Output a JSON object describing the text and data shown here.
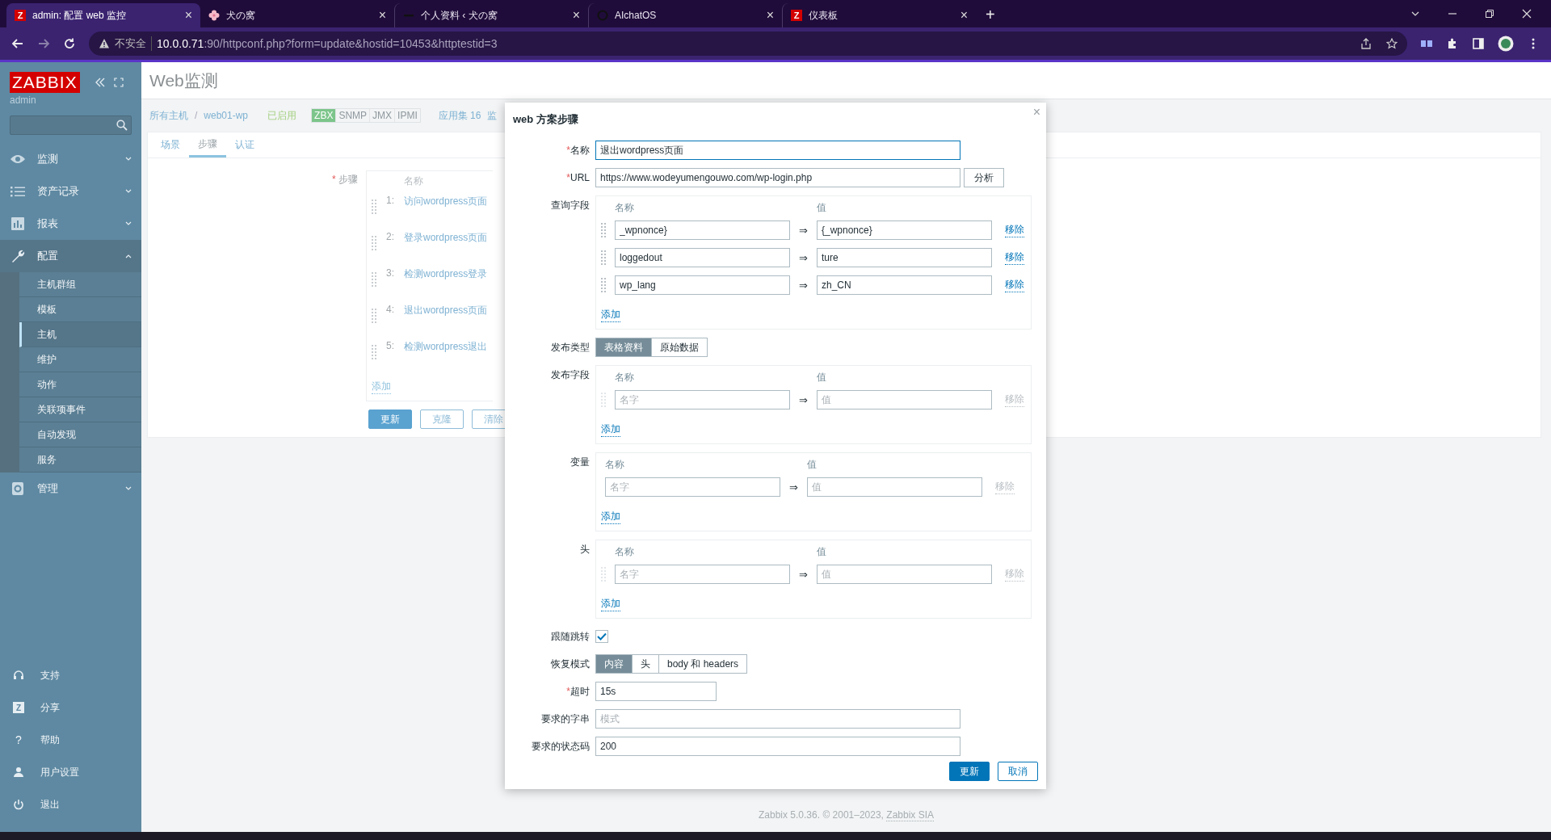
{
  "browser": {
    "tabs": [
      {
        "title": "admin: 配置 web 监控",
        "selected": true,
        "kind": "letter",
        "favicon_text": "Z",
        "close": "×"
      },
      {
        "title": "犬の窝",
        "selected": false,
        "kind": "flower",
        "close": "×"
      },
      {
        "title": "个人资料 ‹ 犬の窝",
        "selected": false,
        "kind": "dash",
        "close": "×"
      },
      {
        "title": "AIchatOS",
        "selected": false,
        "kind": "ring",
        "close": "×"
      },
      {
        "title": "仪表板",
        "selected": false,
        "kind": "letter",
        "favicon_text": "Z",
        "close": "×"
      }
    ],
    "new_tab": "+",
    "security": "不安全",
    "url_host": "10.0.0.71",
    "url_rest": ":90/httpconf.php?form=update&hostid=10453&httptestid=3"
  },
  "sidebar": {
    "logo": "ZABBIX",
    "user": "admin",
    "menu": [
      {
        "label": "监测",
        "kind": "eye",
        "expanded": false
      },
      {
        "label": "资产记录",
        "kind": "list",
        "expanded": false
      },
      {
        "label": "报表",
        "kind": "chart",
        "expanded": false
      },
      {
        "label": "配置",
        "kind": "wrench",
        "expanded": true,
        "children": [
          {
            "label": "主机群组",
            "selected": false
          },
          {
            "label": "模板",
            "selected": false
          },
          {
            "label": "主机",
            "selected": true
          },
          {
            "label": "维护",
            "selected": false
          },
          {
            "label": "动作",
            "selected": false
          },
          {
            "label": "关联项事件",
            "selected": false
          },
          {
            "label": "自动发现",
            "selected": false
          },
          {
            "label": "服务",
            "selected": false
          }
        ]
      },
      {
        "label": "管理",
        "kind": "gear",
        "expanded": false
      }
    ],
    "bottom": [
      {
        "label": "支持",
        "kind": "headset"
      },
      {
        "label": "分享",
        "kind": "letter",
        "icon_text": "Z"
      },
      {
        "label": "帮助",
        "kind": "question",
        "icon_text": "?"
      },
      {
        "label": "用户设置",
        "kind": "user"
      },
      {
        "label": "退出",
        "kind": "power"
      }
    ]
  },
  "page": {
    "title": "Web监测",
    "breadcrumb": [
      {
        "label": "所有主机",
        "separator": "/"
      },
      {
        "label": "web01-wp"
      }
    ],
    "status": "已启用",
    "availability": [
      {
        "label": "ZBX",
        "on": true
      },
      {
        "label": "SNMP",
        "on": false
      },
      {
        "label": "JMX",
        "on": false
      },
      {
        "label": "IPMI",
        "on": false
      }
    ],
    "applications": "应用集 16",
    "cut_link": "监",
    "tabs": [
      {
        "label": "场景",
        "selected": false
      },
      {
        "label": "步骤",
        "selected": true
      },
      {
        "label": "认证",
        "selected": false
      }
    ],
    "steps": {
      "label": "步骤",
      "mark": "*",
      "header": "名称",
      "rows": [
        {
          "number": "1:",
          "name": "访问wordpress页面"
        },
        {
          "number": "2:",
          "name": "登录wordpress页面"
        },
        {
          "number": "3:",
          "name": "检测wordpress登录"
        },
        {
          "number": "4:",
          "name": "退出wordpress页面"
        },
        {
          "number": "5:",
          "name": "检测wordpress退出"
        }
      ],
      "add": "添加"
    },
    "buttons": [
      {
        "label": "更新",
        "primary": true
      },
      {
        "label": "克隆",
        "primary": false
      },
      {
        "label": "清除",
        "primary": false
      }
    ],
    "footer": {
      "text": "Zabbix 5.0.36. © 2001–2023,",
      "link": "Zabbix SIA"
    }
  },
  "dialog": {
    "title": "web 方案步骤",
    "close": "×",
    "form": [
      {
        "kind": "input",
        "label": "名称",
        "mark": "*",
        "value": "退出wordpress页面",
        "focused": true
      },
      {
        "kind": "url",
        "label": "URL",
        "mark": "*",
        "value": "https://www.wodeyumengouwo.com/wp-login.php",
        "button": "分析"
      },
      {
        "kind": "pairs",
        "label": "查询字段",
        "draggable": true,
        "header_name": "名称",
        "header_value": "值",
        "add": "添加",
        "rows": [
          {
            "name": "_wpnonce}",
            "value": "{_wpnonce}",
            "arrow": "⇒",
            "remove": "移除",
            "disabled": false
          },
          {
            "name": "loggedout",
            "value": "ture",
            "arrow": "⇒",
            "remove": "移除",
            "disabled": false
          },
          {
            "name": "wp_lang",
            "value": "zh_CN",
            "arrow": "⇒",
            "remove": "移除",
            "disabled": false
          }
        ]
      },
      {
        "kind": "segmented",
        "label": "发布类型",
        "options": [
          {
            "label": "表格资料",
            "selected": true
          },
          {
            "label": "原始数据",
            "selected": false
          }
        ]
      },
      {
        "kind": "pairs",
        "label": "发布字段",
        "draggable": true,
        "header_name": "名称",
        "header_value": "值",
        "add": "添加",
        "rows": [
          {
            "name_placeholder": "名字",
            "value_placeholder": "值",
            "arrow": "⇒",
            "remove": "移除",
            "disabled": true
          }
        ]
      },
      {
        "kind": "pairs",
        "label": "变量",
        "draggable": false,
        "header_name": "名称",
        "header_value": "值",
        "add": "添加",
        "rows": [
          {
            "name_placeholder": "名字",
            "value_placeholder": "值",
            "arrow": "⇒",
            "remove": "移除",
            "disabled": true
          }
        ]
      },
      {
        "kind": "pairs",
        "label": "头",
        "draggable": true,
        "header_name": "名称",
        "header_value": "值",
        "add": "添加",
        "rows": [
          {
            "name_placeholder": "名字",
            "value_placeholder": "值",
            "arrow": "⇒",
            "remove": "移除",
            "disabled": true
          }
        ]
      },
      {
        "kind": "checkbox",
        "label": "跟随跳转",
        "checked": true
      },
      {
        "kind": "segmented",
        "label": "恢复模式",
        "options": [
          {
            "label": "内容",
            "selected": true
          },
          {
            "label": "头",
            "selected": false
          },
          {
            "label": "body 和 headers",
            "selected": false
          }
        ]
      },
      {
        "kind": "short_input",
        "label": "超时",
        "mark": "*",
        "value": "15s"
      },
      {
        "kind": "input",
        "label": "要求的字串",
        "placeholder": "模式"
      },
      {
        "kind": "input",
        "label": "要求的状态码",
        "value": "200"
      }
    ],
    "buttons": [
      {
        "label": "更新",
        "primary": true
      },
      {
        "label": "取消",
        "primary": false
      }
    ]
  }
}
